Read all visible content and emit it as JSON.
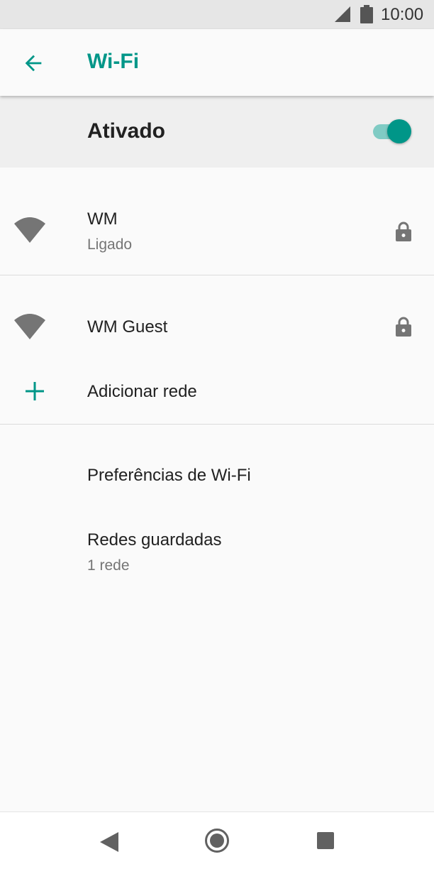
{
  "status_bar": {
    "time": "10:00",
    "icons": [
      "signal-icon",
      "battery-icon"
    ]
  },
  "app_bar": {
    "title": "Wi-Fi",
    "back_icon": "arrow-left-icon"
  },
  "master_switch": {
    "label": "Ativado",
    "enabled": true
  },
  "networks": [
    {
      "name": "WM",
      "status": "Ligado",
      "secured": true,
      "icon": "wifi-signal-icon"
    },
    {
      "name": "WM Guest",
      "status": "",
      "secured": true,
      "icon": "wifi-signal-icon"
    }
  ],
  "add_network": {
    "label": "Adicionar rede",
    "icon": "plus-icon"
  },
  "preferences": {
    "label": "Preferências de Wi-Fi"
  },
  "saved_networks": {
    "label": "Redes guardadas",
    "summary": "1 rede"
  },
  "colors": {
    "accent": "#009688",
    "accent_light": "#80cbc4",
    "icon_gray": "#757575"
  }
}
